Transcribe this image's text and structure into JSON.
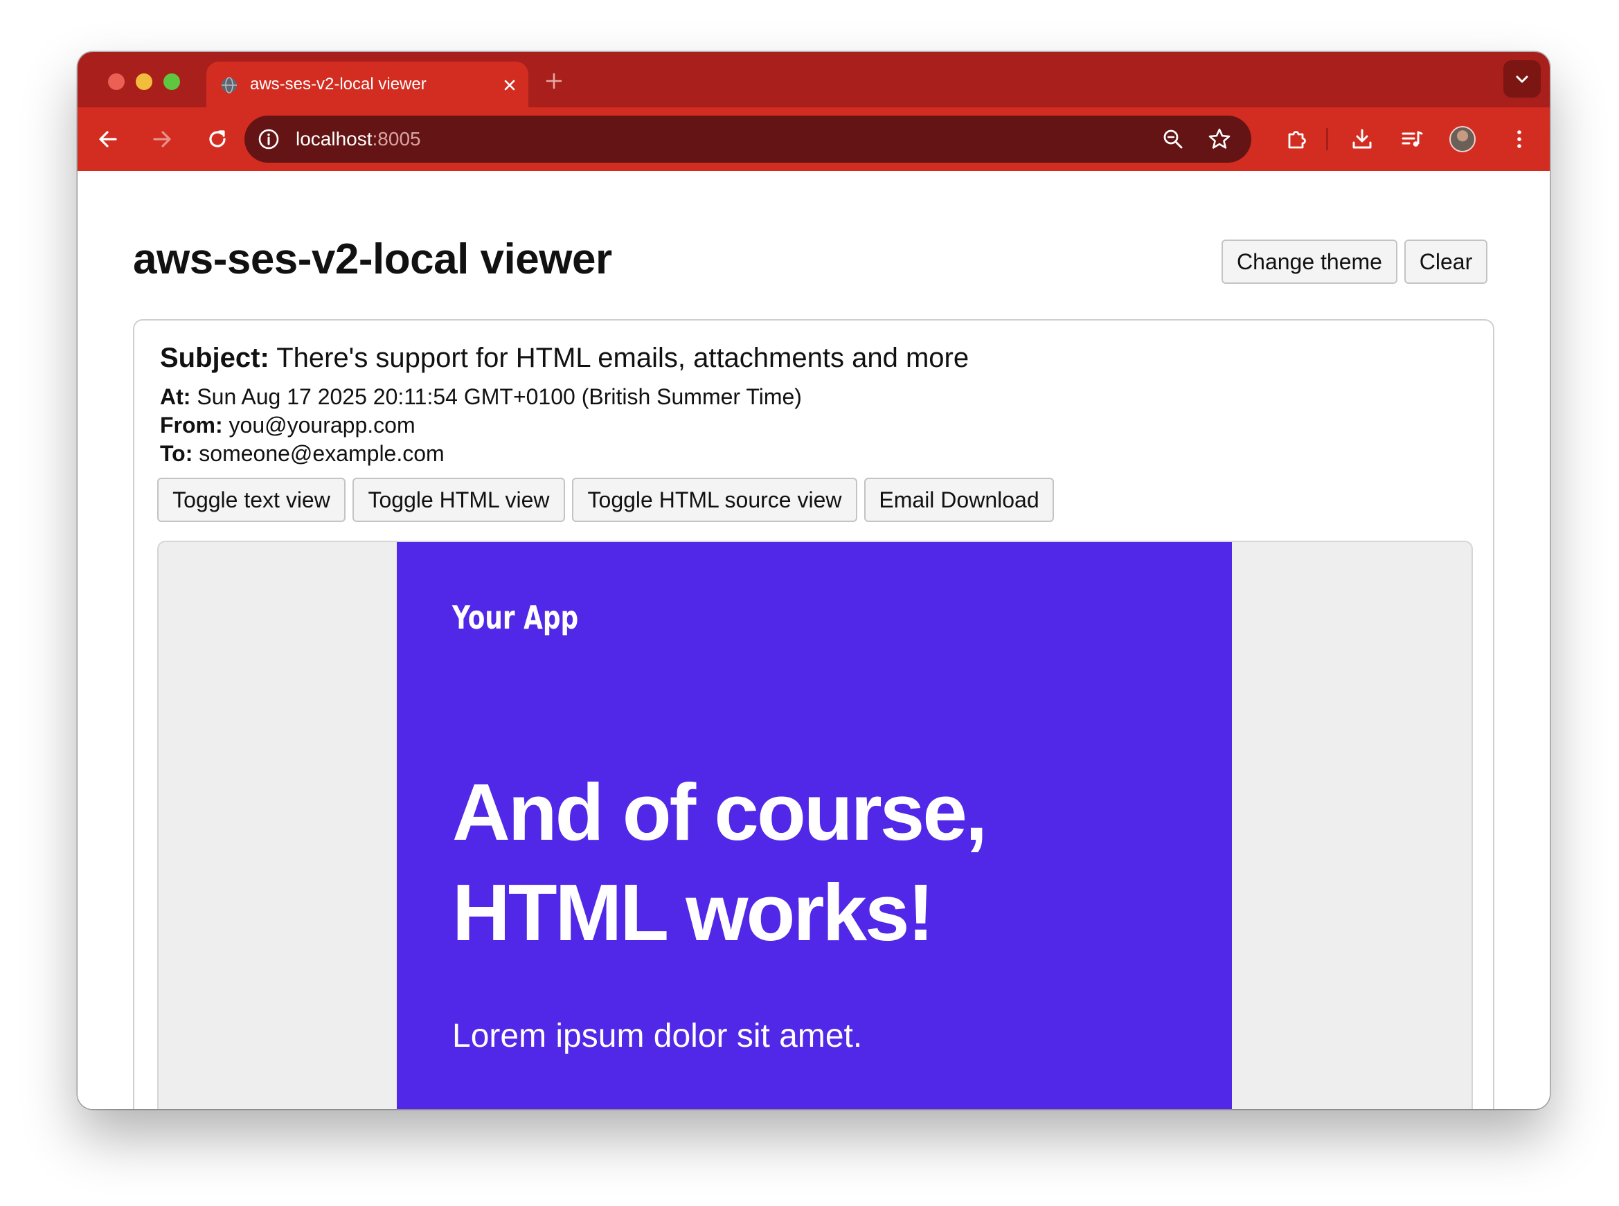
{
  "browser": {
    "tab_title": "aws-ses-v2-local viewer",
    "url_host": "localhost",
    "url_port": ":8005",
    "icons": [
      "globe-icon",
      "close-icon",
      "plus-icon",
      "chevron-down-icon",
      "back-icon",
      "forward-icon",
      "reload-icon",
      "info-icon",
      "zoom-icon",
      "star-icon",
      "extensions-icon",
      "download-icon",
      "media-icon",
      "avatar",
      "more-icon"
    ],
    "colors": {
      "tabstrip": "#a91f1b",
      "toolbar": "#d32c20",
      "omnibox": "#641414"
    }
  },
  "page": {
    "title": "aws-ses-v2-local viewer",
    "buttons": {
      "change_theme": "Change theme",
      "clear": "Clear"
    }
  },
  "email": {
    "subject_label": "Subject:",
    "subject": "There's support for HTML emails, attachments and more",
    "at_label": "At:",
    "at": "Sun Aug 17 2025 20:11:54 GMT+0100 (British Summer Time)",
    "from_label": "From:",
    "from": "you@yourapp.com",
    "to_label": "To:",
    "to": "someone@example.com",
    "actions": {
      "toggle_text": "Toggle text view",
      "toggle_html": "Toggle HTML view",
      "toggle_source": "Toggle HTML source view",
      "download": "Email Download"
    },
    "html_preview": {
      "brand": "Your App",
      "headline": "And of course, HTML works!",
      "lead": "Lorem ipsum dolor sit amet.",
      "background_color": "#5127e8"
    }
  }
}
